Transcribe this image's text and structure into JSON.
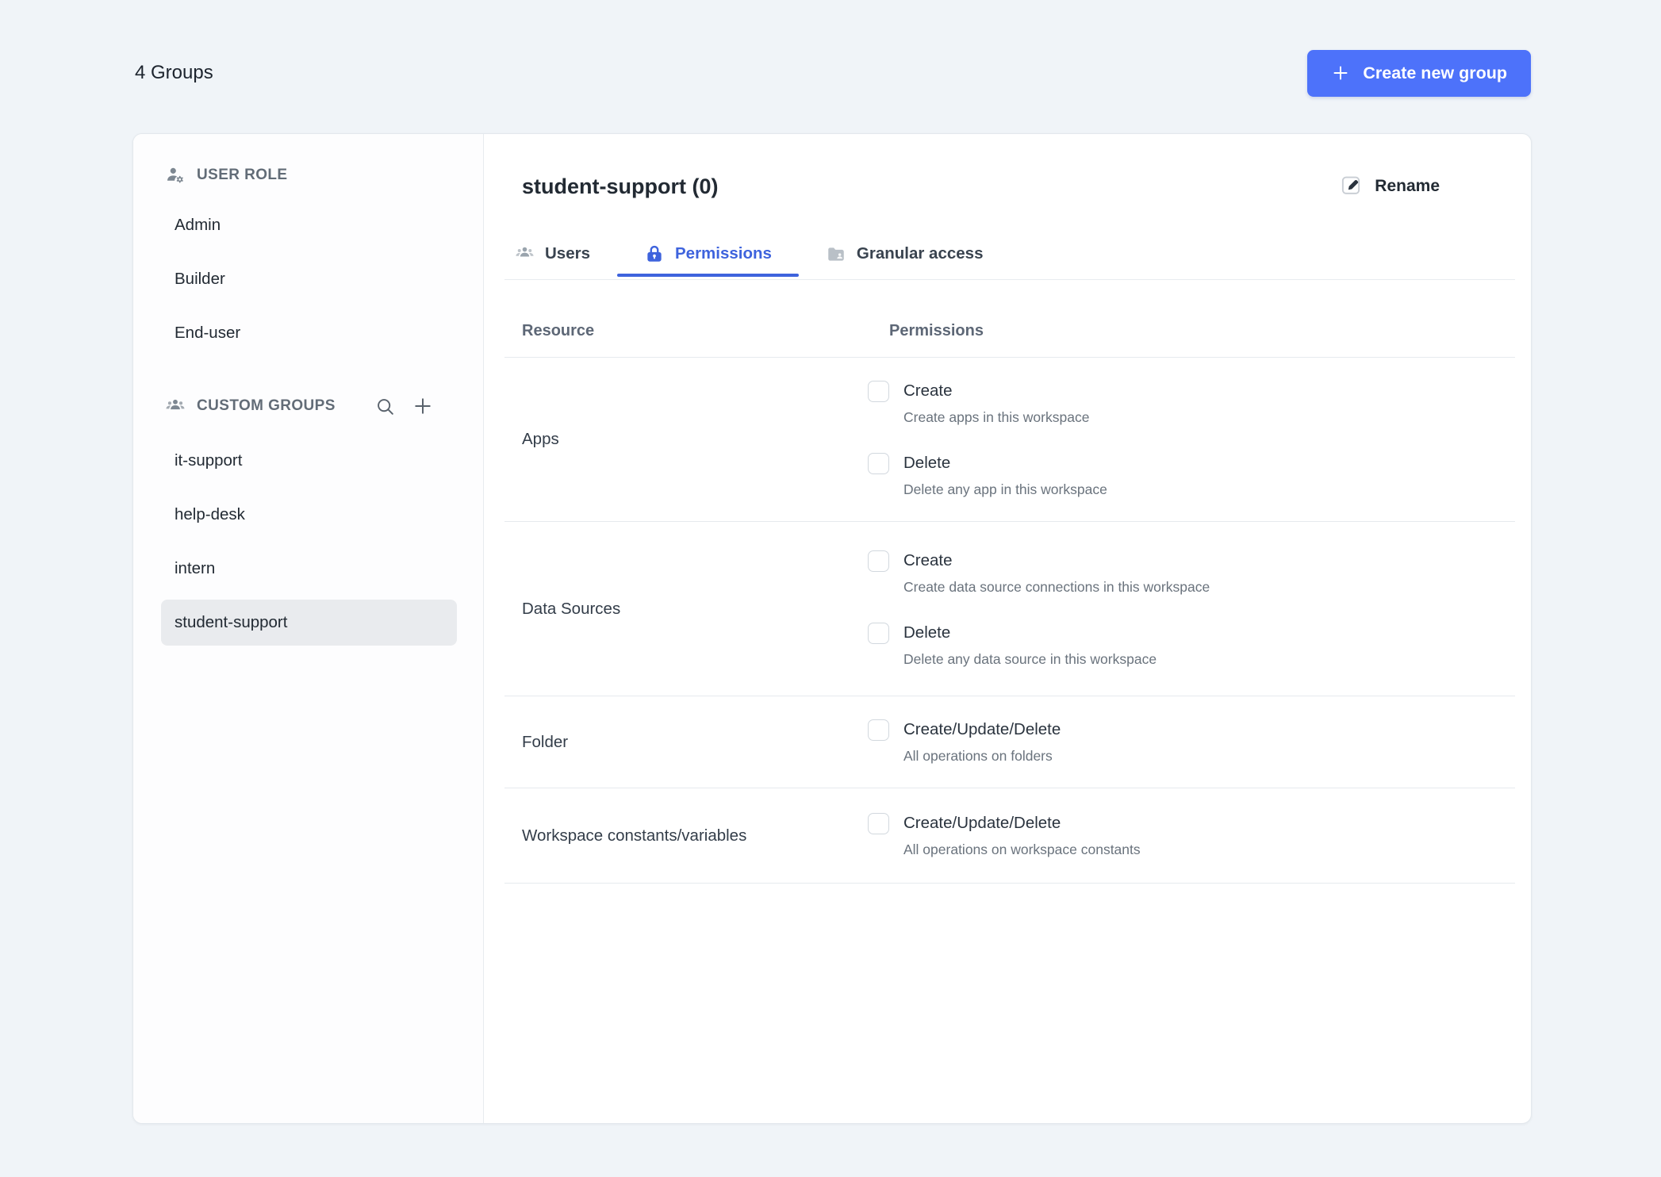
{
  "page": {
    "title": "4 Groups"
  },
  "actions": {
    "create_group": "Create new group"
  },
  "sidebar": {
    "sections": [
      {
        "label": "USER ROLE",
        "icon": "person-gear-icon",
        "items": [
          {
            "label": "Admin"
          },
          {
            "label": "Builder"
          },
          {
            "label": "End-user"
          }
        ]
      },
      {
        "label": "CUSTOM GROUPS",
        "icon": "people-group-icon",
        "tools": [
          "search-icon",
          "plus-icon"
        ],
        "items": [
          {
            "label": "it-support"
          },
          {
            "label": "help-desk"
          },
          {
            "label": "intern"
          },
          {
            "label": "student-support",
            "selected": true
          }
        ]
      }
    ]
  },
  "main": {
    "title": "student-support (0)",
    "rename_label": "Rename",
    "tabs": [
      {
        "label": "Users",
        "icon": "users-icon",
        "active": false
      },
      {
        "label": "Permissions",
        "icon": "lock-icon",
        "active": true
      },
      {
        "label": "Granular access",
        "icon": "folder-user-icon",
        "active": false
      }
    ],
    "table": {
      "columns": {
        "resource": "Resource",
        "permissions": "Permissions"
      },
      "rows": [
        {
          "resource": "Apps",
          "permissions": [
            {
              "name": "Create",
              "description": "Create apps in this workspace",
              "checked": false
            },
            {
              "name": "Delete",
              "description": "Delete any app in this workspace",
              "checked": false
            }
          ]
        },
        {
          "resource": "Data Sources",
          "permissions": [
            {
              "name": "Create",
              "description": "Create data source connections in this workspace",
              "checked": false
            },
            {
              "name": "Delete",
              "description": "Delete any data source in this workspace",
              "checked": false
            }
          ]
        },
        {
          "resource": "Folder",
          "permissions": [
            {
              "name": "Create/Update/Delete",
              "description": "All operations on folders",
              "checked": false
            }
          ]
        },
        {
          "resource": "Workspace constants/variables",
          "permissions": [
            {
              "name": "Create/Update/Delete",
              "description": "All operations on workspace constants",
              "checked": false
            }
          ]
        }
      ]
    }
  },
  "colors": {
    "page_bg": "#f0f4f8",
    "primary_button": "#4d72fa",
    "active_tab": "#3e63dd",
    "selected_item_bg": "#e9ebee",
    "divider": "#e6eaee"
  }
}
